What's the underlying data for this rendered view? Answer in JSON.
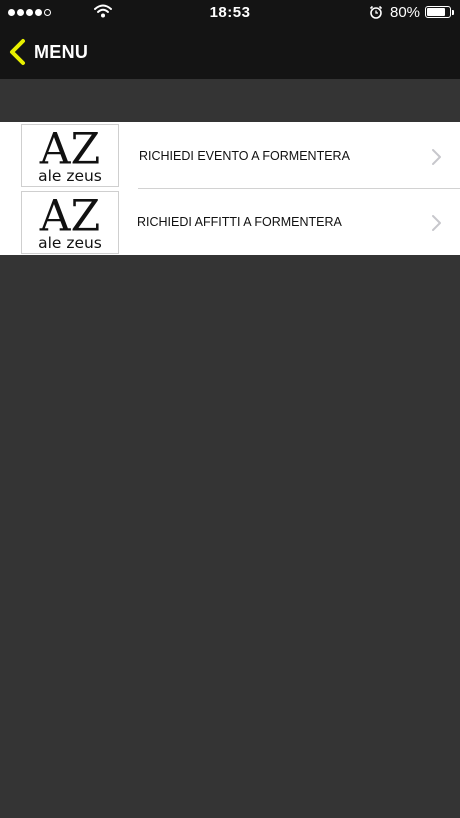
{
  "status_bar": {
    "time": "18:53",
    "battery_percent": "80%",
    "battery_level": 0.8,
    "signal_bars_filled": 4,
    "signal_bars_total": 5,
    "icons": [
      "signal-dots-icon",
      "wifi-icon",
      "alarm-clock-icon",
      "battery-icon"
    ]
  },
  "nav": {
    "back_label": "MENU",
    "accent_color": "#e8f000"
  },
  "menu": {
    "items": [
      {
        "label": "RICHIEDI EVENTO A FORMENTERA",
        "logo_big": "AZ",
        "logo_small": "ale zeus"
      },
      {
        "label": "RICHIEDI AFFITTI A FORMENTERA",
        "logo_big": "AZ",
        "logo_small": "ale zeus"
      }
    ]
  },
  "colors": {
    "background": "#343434",
    "header": "#141414",
    "list_background": "#ffffff",
    "chevron": "#c7c7cc"
  }
}
